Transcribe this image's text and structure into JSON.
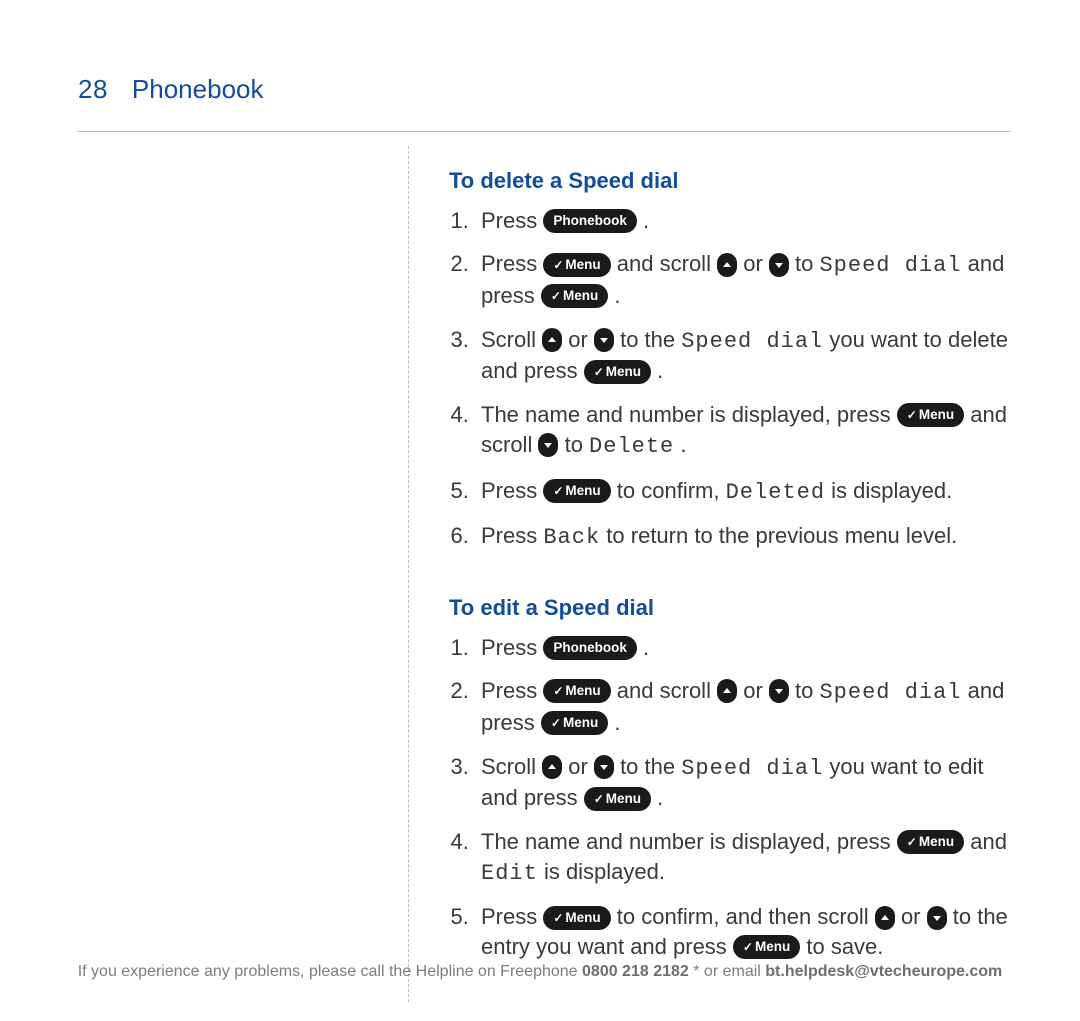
{
  "page_number": "28",
  "section_title": "Phonebook",
  "buttons": {
    "phonebook": "Phonebook",
    "menu": "Menu"
  },
  "lcd": {
    "speed_dial": "Speed dial",
    "delete": "Delete",
    "deleted": "Deleted",
    "back": "Back",
    "edit": "Edit"
  },
  "sections": {
    "delete": {
      "title": "To delete a Speed dial",
      "steps": {
        "s1a": "Press ",
        "s1b": ".",
        "s2a": "Press ",
        "s2b": " and scroll ",
        "s2c": " or ",
        "s2d": " to ",
        "s2e": " and press ",
        "s2f": ".",
        "s3a": "Scroll",
        "s3b": " or ",
        "s3c": " to the ",
        "s3d": " you want to delete and press ",
        "s3e": ".",
        "s4a": "The name and number is displayed, press ",
        "s4b": " and scroll ",
        "s4c": " to ",
        "s4d": ".",
        "s5a": "Press ",
        "s5b": " to confirm, ",
        "s5c": " is displayed.",
        "s6a": "Press ",
        "s6b": " to return to the previous menu level."
      }
    },
    "edit": {
      "title": "To edit a Speed dial",
      "steps": {
        "s1a": "Press ",
        "s1b": ".",
        "s2a": "Press ",
        "s2b": " and scroll ",
        "s2c": " or ",
        "s2d": " to ",
        "s2e": " and press ",
        "s2f": ".",
        "s3a": "Scroll ",
        "s3b": " or ",
        "s3c": " to the ",
        "s3d": " you want to edit and press ",
        "s3e": ".",
        "s4a": "The name and number is displayed, press ",
        "s4b": " and ",
        "s4c": " is displayed.",
        "s5a": "Press ",
        "s5b": " to confirm, and then scroll ",
        "s5c": " or ",
        "s5d": " to the entry you want and press ",
        "s5e": " to save."
      }
    }
  },
  "footer": {
    "a": "If you experience any problems, please call the Helpline on Freephone ",
    "phone": "0800 218 2182",
    "b": "* or email ",
    "email": "bt.helpdesk@vtecheurope.com"
  }
}
